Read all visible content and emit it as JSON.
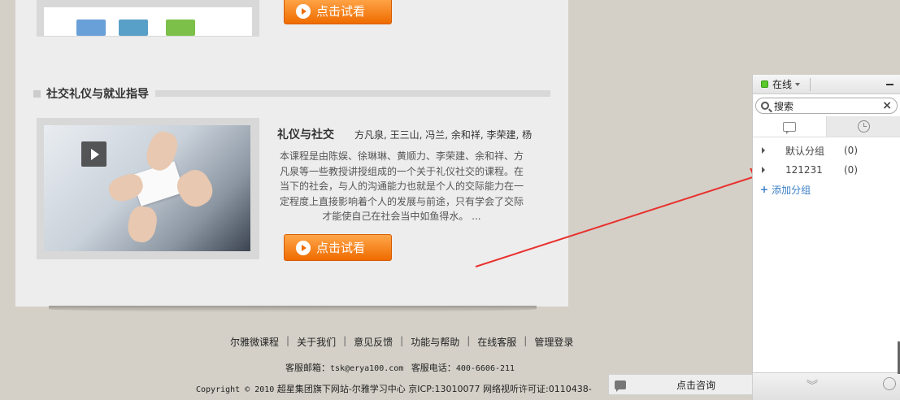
{
  "course_top": {
    "try_label": "点击试看"
  },
  "section": {
    "title": "社交礼仪与就业指导"
  },
  "course": {
    "title": "礼仪与社交",
    "authors": "方凡泉, 王三山, 冯兰, 余和祥, 李荣建, 杨",
    "description": "本课程是由陈娱、徐琳琳、黄顺力、李荣建、余和祥、方凡泉等一些教授讲授组成的一个关于礼仪社交的课程。在当下的社会，与人的沟通能力也就是个人的交际能力在一定程度上直接影响着个人的发展与前途，只有学会了交际才能使自己在社会当中如鱼得水。 ...",
    "try_label": "点击试看"
  },
  "footer": {
    "links": [
      "尔雅微课程",
      "关于我们",
      "意见反馈",
      "功能与帮助",
      "在线客服",
      "管理登录"
    ],
    "email_label": "客服邮箱：",
    "email": "tsk@erya100.com",
    "phone_label": "客服电话：",
    "phone": "400-6606-211",
    "copyright_prefix": "Copyright © 2010",
    "copyright_text": "超星集团旗下网站-尔雅学习中心 京ICP:13010077 网络视听许可证:0110438-"
  },
  "chat": {
    "status": "在线",
    "search_placeholder": "搜索",
    "groups": [
      {
        "name": "默认分组",
        "count": "(0)"
      },
      {
        "name": "121231",
        "count": "(0)"
      }
    ],
    "add_group": "添加分组",
    "consult_label": "点击咨询"
  },
  "colors": {
    "accent_orange": "#ef6c00",
    "online_green": "#5ac82a",
    "arrow_red": "#e8322e",
    "link_blue": "#3a7fc6"
  }
}
